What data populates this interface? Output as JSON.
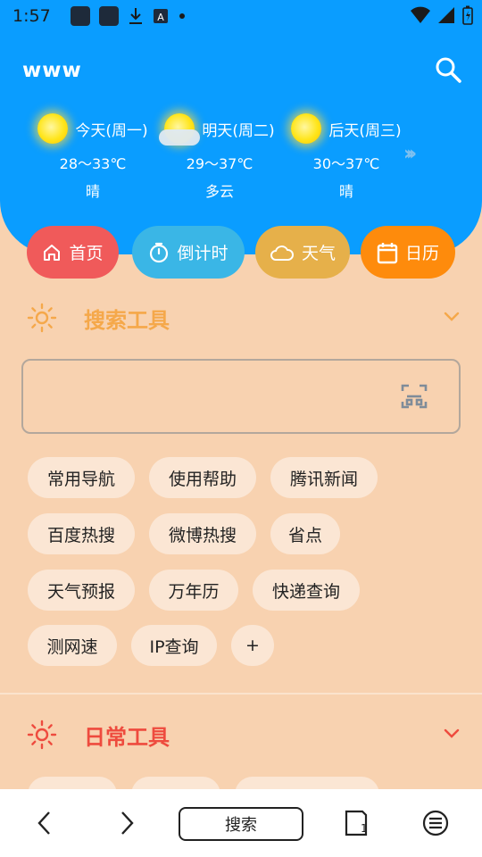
{
  "status_bar": {
    "time": "1:57",
    "icons": [
      "app-square-icon",
      "app-square-icon",
      "download-icon",
      "font-icon",
      "dot-icon",
      "wifi-icon",
      "signal-icon",
      "battery-icon"
    ]
  },
  "header": {
    "title": "www",
    "search_icon": "search-icon"
  },
  "weather": [
    {
      "day": "今天(周一)",
      "temp": "28～33℃",
      "condition": "晴",
      "icon": "sun-icon"
    },
    {
      "day": "明天(周二)",
      "temp": "29～37℃",
      "condition": "多云",
      "icon": "cloud-sun-icon"
    },
    {
      "day": "后天(周三)",
      "temp": "30～37℃",
      "condition": "晴",
      "icon": "sun-icon"
    }
  ],
  "tabs": [
    {
      "label": "首页",
      "icon": "home-icon",
      "color": "#f05a5a"
    },
    {
      "label": "倒计时",
      "icon": "timer-icon",
      "color": "#3ab6e6"
    },
    {
      "label": "天气",
      "icon": "cloud-icon",
      "color": "#e6b04a"
    },
    {
      "label": "日历",
      "icon": "calendar-icon",
      "color": "#fe8b0c"
    }
  ],
  "search_tools": {
    "title": "搜索工具",
    "color": "#f5a84a",
    "input_value": "",
    "chips": [
      "常用导航",
      "使用帮助",
      "腾讯新闻",
      "百度热搜",
      "微博热搜",
      "省点",
      "天气预报",
      "万年历",
      "快递查询",
      "测网速",
      "IP查询",
      "+"
    ]
  },
  "daily_tools": {
    "title": "日常工具",
    "color": "#ee4b3e"
  },
  "bottom_nav": {
    "back_icon": "chevron-left-icon",
    "forward_icon": "chevron-right-icon",
    "search_label": "搜索",
    "tabs_count": "1",
    "menu_icon": "menu-icon"
  }
}
